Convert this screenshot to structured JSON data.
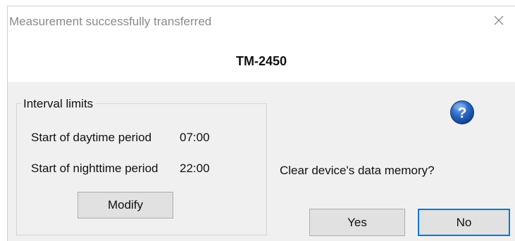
{
  "window": {
    "title": "Measurement successfully transferred",
    "close_icon": "close-icon"
  },
  "device": {
    "name": "TM-2450"
  },
  "interval_limits": {
    "legend": "Interval limits",
    "rows": [
      {
        "label": "Start of daytime period",
        "value": "07:00"
      },
      {
        "label": "Start of nighttime period",
        "value": "22:00"
      }
    ],
    "modify_label": "Modify"
  },
  "question": {
    "icon": "question-icon",
    "icon_color": "#1f5fb4",
    "text": "Clear device's data memory?"
  },
  "buttons": {
    "yes_label": "Yes",
    "no_label": "No"
  },
  "colors": {
    "dialog_background": "#f0f0f0",
    "header_background": "#ffffff",
    "default_button_border": "#0078d7",
    "title_text": "#8a8a8a"
  }
}
